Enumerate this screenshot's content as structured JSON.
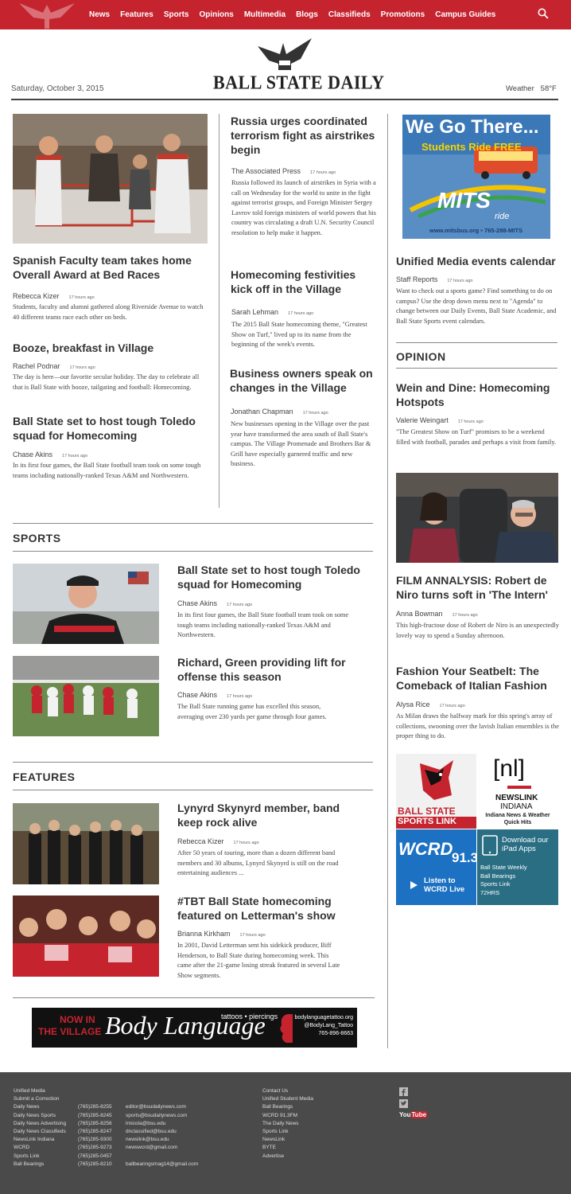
{
  "nav": {
    "items": [
      "News",
      "Features",
      "Sports",
      "Opinions",
      "Multimedia",
      "Blogs",
      "Classifieds",
      "Promotions",
      "Campus Guides"
    ]
  },
  "masthead": {
    "title": "BALL STATE DAILY",
    "date": "Saturday, October 3, 2015",
    "weather_label": "Weather",
    "weather_temp": "58°F"
  },
  "lead": {
    "headline": "Spanish Faculty team takes home Overall Award at Bed Races",
    "author": "Rebecca Kizer",
    "time": "17 hours ago",
    "teaser": "Students, faculty and alumni gathered along Riverside Avenue to watch 40 different teams race each other on beds."
  },
  "left_stories": [
    {
      "headline": "Booze, breakfast in Village",
      "author": "Rachel Podnar",
      "time": "17 hours ago",
      "teaser": "The day is here—our favorite secular holiday. The day to celebrate all that is Ball State with booze, tailgating and football: Homecoming."
    },
    {
      "headline": "Ball State set to host tough Toledo squad for Homecoming",
      "author": "Chase Akins",
      "time": "17 hours ago",
      "teaser": "In its first four games, the Ball State football team took on some tough teams including nationally-ranked Texas A&M and Northwestern."
    }
  ],
  "mid_stories": [
    {
      "headline": "Russia urges coordinated terrorism fight as airstrikes begin",
      "author": "The Associated Press",
      "time": "17 hours ago",
      "teaser": "Russia followed its launch of airstrikes in Syria with a call on Wednesday for the world to unite in the fight against terrorist groups, and Foreign Minister Sergey Lavrov told foreign ministers of world powers that his country was circulating a draft U.N. Security Council resolution to help make it happen."
    },
    {
      "headline": "Homecoming festivities kick off in the Village",
      "author": "Sarah Lehman",
      "time": "17 hours ago",
      "teaser": "The 2015 Ball State homecoming theme, \"Greatest Show on Turf,\" lived up to its name from the beginning of the week's events."
    },
    {
      "headline": "Business owners speak on changes in the Village",
      "author": "Jonathan Chapman",
      "time": "17 hours ago",
      "teaser": "New businesses opening in the Village over the past year have transformed the area south of Ball State's campus. The Village Promenade and Brothers Bar & Grill have especially garnered traffic and new business."
    }
  ],
  "ad_mits": {
    "line1": "We Go There...",
    "line2": "Students Ride FREE",
    "brand": "MITS",
    "brand_sub": "ride",
    "url": "www.mitsbus.org • 765-288-MITS"
  },
  "right_stories": [
    {
      "headline": "Unified Media events calendar",
      "author": "Staff Reports",
      "time": "17 hours ago",
      "teaser": "Want to check out a sports game? Find something to do on campus? Use the drop down menu next to \"Agenda\" to change between our Daily Events, Ball State Academic, and Ball State Sports event calendars."
    }
  ],
  "opinion": {
    "label": "OPINION",
    "stories": [
      {
        "headline": "Wein and Dine: Homecoming Hotspots",
        "author": "Valerie Weingart",
        "time": "17 hours ago",
        "teaser": "\"The Greatest Show on Turf\" promises to be a weekend filled with football, parades and perhaps a visit from family."
      },
      {
        "headline": "FILM ANNALYSIS: Robert de Niro turns soft in 'The Intern'",
        "author": "Anna Bowman",
        "time": "17 hours ago",
        "teaser": "This high-fructose dose of Robert de Niro is an unexpectedly lovely way to spend a Sunday afternoon."
      },
      {
        "headline": "Fashion Your Seatbelt: The Comeback of Italian Fashion",
        "author": "Alysa Rice",
        "time": "17 hours ago",
        "teaser": "As Milan draws the halfway mark for this spring's array of collections, swooning over the lavish Italian ensembles is the proper thing to do."
      }
    ]
  },
  "sports": {
    "label": "SPORTS",
    "stories": [
      {
        "headline": "Ball State set to host tough Toledo squad for Homecoming",
        "author": "Chase Akins",
        "time": "17 hours ago",
        "teaser": "In its first four games, the Ball State football team took on some tough teams including nationally-ranked Texas A&M and Northwestern."
      },
      {
        "headline": "Richard, Green providing lift for offense this season",
        "author": "Chase Akins",
        "time": "17 hours ago",
        "teaser": "The Ball State running game has excelled this season, averaging over 230 yards per game through four games."
      }
    ]
  },
  "features": {
    "label": "FEATURES",
    "stories": [
      {
        "headline": "Lynyrd Skynyrd member, band keep rock alive",
        "author": "Rebecca Kizer",
        "time": "17 hours ago",
        "teaser": "After 50 years of touring, more than a dozen different band members and 30 albums, Lynyrd Skynyrd is still on the road entertaining audiences ..."
      },
      {
        "headline": "#TBT Ball State homecoming featured on Letterman's show",
        "author": "Brianna Kirkham",
        "time": "17 hours ago",
        "teaser": "In 2001, David Letterman sent his sidekick producer, Biff Henderson, to Ball State during homecoming week. This came after the 21-game losing streak featured in several Late Show segments."
      }
    ]
  },
  "tiles": {
    "sportslink_1": "BALL STATE",
    "sportslink_2": "SPORTS LINK",
    "newslink_logo": "[nl]",
    "newslink_1": "NEWSLINK",
    "newslink_2": "INDIANA",
    "newslink_3": "Indiana News & Weather Quick Hits",
    "wcrd_logo": "WCRD",
    "wcrd_freq": "91.3",
    "wcrd_listen": "Listen to WCRD Live",
    "apps_title": "Download our iPad Apps",
    "apps_list": [
      "Ball State Weekly",
      "Ball Bearings",
      "Sports Link",
      "72HRS"
    ]
  },
  "ad_banner": {
    "line1": "NOW IN",
    "line2": "THE VILLAGE",
    "brand": "Body Language",
    "services": "tattoos • piercings",
    "web": "bodylanguagetattoo.org",
    "handle": "@BodyLang_Tattoo",
    "phone": "765-896-8663"
  },
  "footer": {
    "col1": [
      "Unified Media",
      "Submit a Correction",
      "Daily News",
      "Daily News Sports",
      "Daily News Advertising",
      "Daily News Classifieds",
      "NewsLink Indiana",
      "WCRD",
      "Sports Link",
      "Ball Bearings"
    ],
    "col2": [
      "",
      "",
      "(765)285-8255",
      "(765)285-8245",
      "(765)285-8256",
      "(765)285-8247",
      "(765)285-9300",
      "(765)285-9273",
      "(765)285-0457",
      "(765)285-8210"
    ],
    "col3": [
      "",
      "",
      "editor@bsudailynews.com",
      "sports@bsudailynews.com",
      "lrnicola@bsu.edu",
      "dnclassified@bsu.edu",
      "newslink@bsu.edu",
      "newswcrd@gmail.com",
      "",
      "ballbearingsmag14@gmail.com"
    ],
    "col4": [
      "Contact Us",
      "Unified Student Media",
      "Ball Bearings",
      "WCRD 91.3FM",
      "The Daily News",
      "Sports Link",
      "NewsLink",
      "BYTE",
      "Advertise"
    ],
    "youtube_1": "You",
    "youtube_2": "Tube"
  }
}
